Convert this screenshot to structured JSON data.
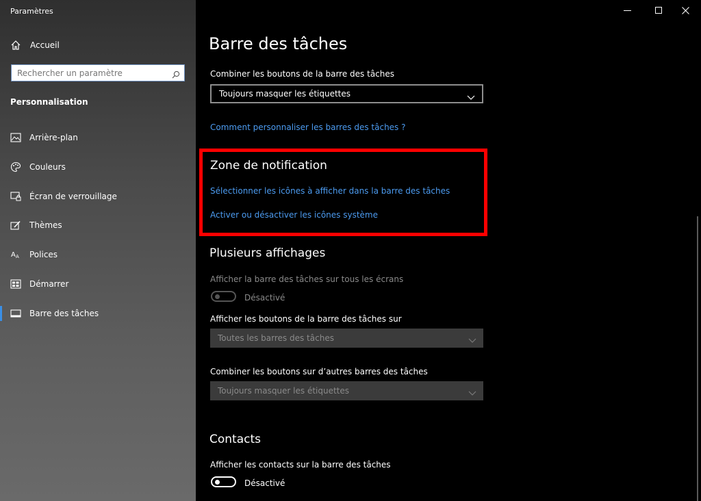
{
  "window": {
    "title": "Paramètres",
    "controls": {
      "minimize": "—",
      "maximize": "☐",
      "close": "✕"
    }
  },
  "sidebar": {
    "home_label": "Accueil",
    "search_placeholder": "Rechercher un paramètre",
    "section_title": "Personnalisation",
    "items": [
      {
        "label": "Arrière-plan",
        "icon": "image-icon"
      },
      {
        "label": "Couleurs",
        "icon": "palette-icon"
      },
      {
        "label": "Écran de verrouillage",
        "icon": "lock-screen-icon"
      },
      {
        "label": "Thèmes",
        "icon": "themes-icon"
      },
      {
        "label": "Polices",
        "icon": "fonts-icon"
      },
      {
        "label": "Démarrer",
        "icon": "start-icon"
      },
      {
        "label": "Barre des tâches",
        "icon": "taskbar-icon",
        "active": true
      }
    ]
  },
  "main": {
    "page_title": "Barre des tâches",
    "combine": {
      "label": "Combiner les boutons de la barre des tâches",
      "value": "Toujours masquer les étiquettes"
    },
    "help_link": "Comment personnaliser les barres des tâches ?",
    "notification": {
      "heading": "Zone de notification",
      "link_select": "Sélectionner les icônes à afficher dans la barre des tâches",
      "link_toggle": "Activer ou désactiver les icônes système"
    },
    "multi": {
      "heading": "Plusieurs affichages",
      "show_all_label": "Afficher la barre des tâches sur tous les écrans",
      "show_all_state": "Désactivé",
      "show_on_label": "Afficher les boutons de la barre des tâches sur",
      "show_on_value": "Toutes les barres des tâches",
      "combine_other_label": "Combiner les boutons sur d’autres barres des tâches",
      "combine_other_value": "Toujours masquer les étiquettes"
    },
    "contacts": {
      "heading": "Contacts",
      "label": "Afficher les contacts sur la barre des tâches",
      "state": "Désactivé"
    }
  },
  "colors": {
    "accent_link": "#4c9bf0",
    "highlight": "#ff0000",
    "background": "#000000"
  }
}
